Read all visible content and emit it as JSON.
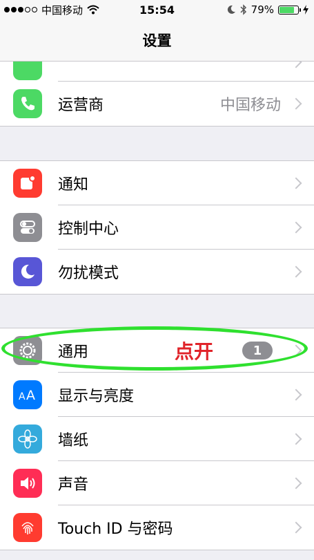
{
  "status_bar": {
    "carrier": "中国移动",
    "time": "15:54",
    "battery_percent": "79%",
    "battery_level": 0.79,
    "signal_bars_filled": 3,
    "signal_bars_total": 5
  },
  "nav": {
    "title": "设置"
  },
  "groups": [
    {
      "items": [
        {
          "label": "运营商",
          "value": "中国移动",
          "icon": "phone-icon",
          "color": "#4cd964"
        }
      ]
    },
    {
      "items": [
        {
          "label": "通知",
          "icon": "notification-icon",
          "color": "#ff3b30"
        },
        {
          "label": "控制中心",
          "icon": "toggles-icon",
          "color": "#8e8e93"
        },
        {
          "label": "勿扰模式",
          "icon": "moon-icon",
          "color": "#5856d6"
        }
      ]
    },
    {
      "items": [
        {
          "label": "通用",
          "badge": "1",
          "annotation": "点开",
          "icon": "gear-icon",
          "color": "#8e8e93"
        },
        {
          "label": "显示与亮度",
          "icon": "text-size-icon",
          "color": "#007aff"
        },
        {
          "label": "墙纸",
          "icon": "flower-icon",
          "color": "#34aadc"
        },
        {
          "label": "声音",
          "icon": "speaker-icon",
          "color": "#ff2d55"
        },
        {
          "label": "Touch ID 与密码",
          "icon": "fingerprint-icon",
          "color": "#ff3b30"
        }
      ]
    }
  ],
  "colors": {
    "annotation": "#e0242a",
    "highlight_ring": "#2fe02f"
  }
}
